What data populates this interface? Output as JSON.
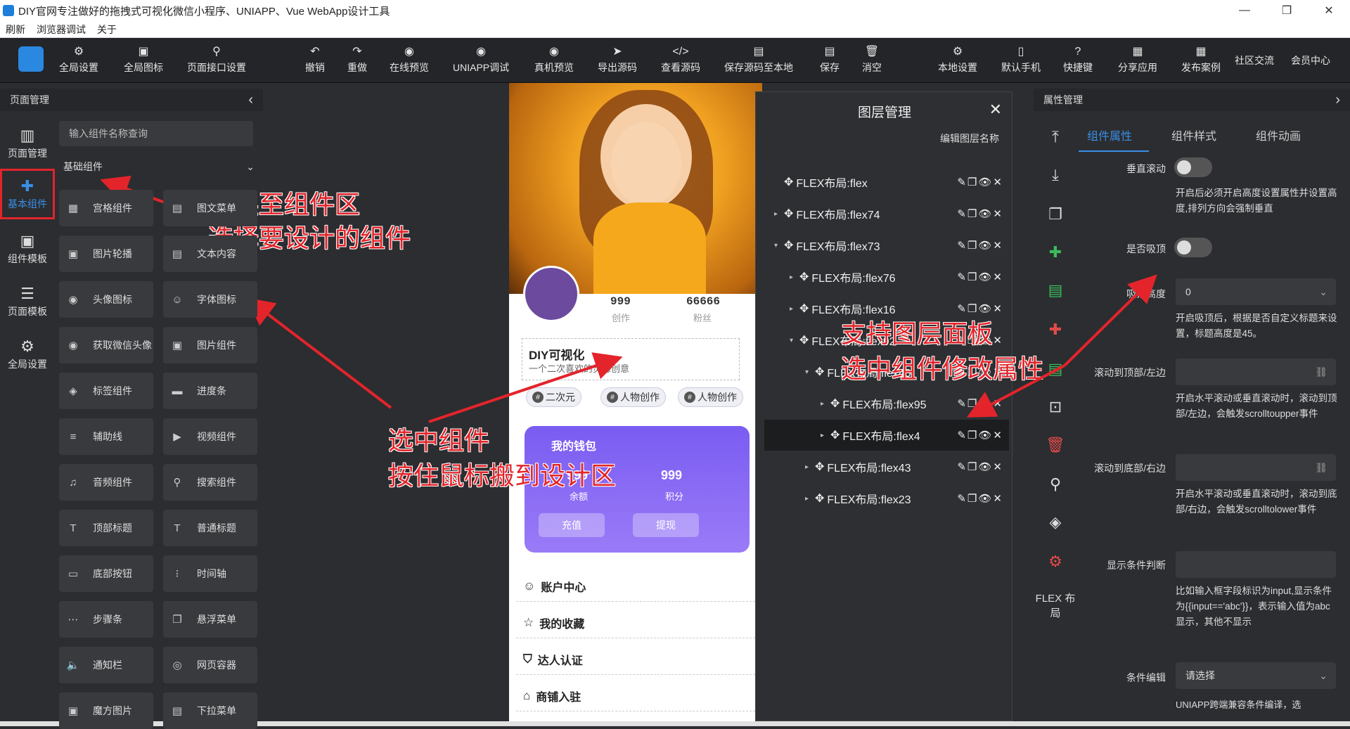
{
  "window": {
    "title": "DIY官网专注做好的拖拽式可视化微信小程序、UNIAPP、Vue WebApp设计工具",
    "controls": [
      "—",
      "❐",
      "✕"
    ]
  },
  "menu": [
    "刷新",
    "浏览器调试",
    "关于"
  ],
  "toolbar": {
    "left": [
      "全局设置",
      "全局图标",
      "页面接口设置"
    ],
    "center": [
      "撤销",
      "重做",
      "在线预览",
      "UNIAPP调试",
      "真机预览",
      "导出源码",
      "查看源码",
      "保存源码至本地",
      "保存",
      "消空"
    ],
    "right": [
      "本地设置",
      "默认手机",
      "快捷键",
      "分享应用",
      "发布案例"
    ],
    "text_only": [
      "社区交流",
      "会员中心"
    ]
  },
  "left_rail": [
    {
      "label": "页面管理",
      "icon": "page-icon"
    },
    {
      "label": "基本组件",
      "icon": "puzzle-icon",
      "active": true
    },
    {
      "label": "组件模板",
      "icon": "template-icon"
    },
    {
      "label": "页面模板",
      "icon": "database-icon"
    },
    {
      "label": "全局设置",
      "icon": "gear-icon"
    }
  ],
  "component_panel": {
    "header": "页面管理",
    "search_placeholder": "输入组件名称查询",
    "group": "基础组件",
    "items": [
      [
        "宫格组件",
        "图文菜单"
      ],
      [
        "图片轮播",
        "文本内容"
      ],
      [
        "头像图标",
        "字体图标"
      ],
      [
        "获取微信头像",
        "图片组件"
      ],
      [
        "标签组件",
        "进度条"
      ],
      [
        "辅助线",
        "视频组件"
      ],
      [
        "音频组件",
        "搜索组件"
      ],
      [
        "顶部标题",
        "普通标题"
      ],
      [
        "底部按钮",
        "时间轴"
      ],
      [
        "步骤条",
        "悬浮菜单"
      ],
      [
        "通知栏",
        "网页容器"
      ],
      [
        "魔方图片",
        "下拉菜单"
      ]
    ]
  },
  "phone": {
    "stats": [
      {
        "value": "999",
        "label": "创作"
      },
      {
        "value": "66666",
        "label": "粉丝"
      }
    ],
    "card_title": "DIY可视化",
    "card_sub": "一个二次喜欢的灵感创意",
    "tags": [
      "二次元",
      "人物创作",
      "人物创作"
    ],
    "wallet": {
      "title": "我的钱包",
      "items": [
        {
          "value": "999",
          "label": "余额",
          "btn": "充值"
        },
        {
          "value": "999",
          "label": "积分",
          "btn": "提现"
        }
      ]
    },
    "list": [
      "账户中心",
      "我的收藏",
      "达人认证",
      "商铺入驻"
    ]
  },
  "layer_panel": {
    "title": "图层管理",
    "edit_label": "编辑图层名称",
    "layers": [
      {
        "name": "FLEX布局:flex",
        "depth": 0,
        "caret": ""
      },
      {
        "name": "FLEX布局:flex74",
        "depth": 0,
        "caret": "▸"
      },
      {
        "name": "FLEX布局:flex73",
        "depth": 0,
        "caret": "▾"
      },
      {
        "name": "FLEX布局:flex76",
        "depth": 1,
        "caret": "▸"
      },
      {
        "name": "FLEX布局:flex16",
        "depth": 1,
        "caret": "▸"
      },
      {
        "name": "FLEX布局:flex92",
        "depth": 1,
        "caret": "▾"
      },
      {
        "name": "FLEX布局:flex40",
        "depth": 2,
        "caret": "▾"
      },
      {
        "name": "FLEX布局:flex95",
        "depth": 3,
        "caret": "▸"
      },
      {
        "name": "FLEX布局:flex4",
        "depth": 3,
        "caret": "▸",
        "selected": true
      },
      {
        "name": "FLEX布局:flex43",
        "depth": 2,
        "caret": "▸"
      },
      {
        "name": "FLEX布局:flex23",
        "depth": 2,
        "caret": "▸"
      }
    ],
    "actions": "✎❐👁✕"
  },
  "props": {
    "header": "属性管理",
    "tabs": [
      "组件属性",
      "组件样式",
      "组件动画"
    ],
    "flex_label": "FLEX 布局",
    "fields": {
      "vscroll_label": "垂直滚动",
      "vscroll_desc": "开启后必须开启高度设置属性并设置高度,排列方向会强制垂直",
      "sticky_label": "是否吸顶",
      "sticky_height_label": "吸顶高度",
      "sticky_height_value": "0",
      "sticky_desc": "开启吸顶后，根据是否自定义标题来设置，标题高度是45。",
      "scroll_top_label": "滚动到顶部/左边",
      "scroll_top_desc": "开启水平滚动或垂直滚动时，滚动到顶部/左边，会触发scrolltoupper事件",
      "scroll_bottom_label": "滚动到底部/右边",
      "scroll_bottom_desc": "开启水平滚动或垂直滚动时，滚动到底部/右边，会触发scrolltolower事件",
      "condition_label": "显示条件判断",
      "condition_desc": "比如输入框字段标识为input,显示条件为{{input=='abc'}}，表示输入值为abc显示，其他不显示",
      "cond_edit_label": "条件编辑",
      "cond_edit_placeholder": "请选择",
      "uniapp_note": "UNIAPP跨端兼容条件编译，选"
    }
  },
  "annotations": {
    "a1": "切换至组件区",
    "a2": "选择要设计的组件",
    "a3": "选中组件",
    "a4": "按住鼠标搬到设计区",
    "a5": "支持图层面板",
    "a6": "选中组件修改属性"
  },
  "colors": {
    "accent": "#3a8ee6",
    "annotation": "#e3242b",
    "bg": "#2b2d30"
  }
}
